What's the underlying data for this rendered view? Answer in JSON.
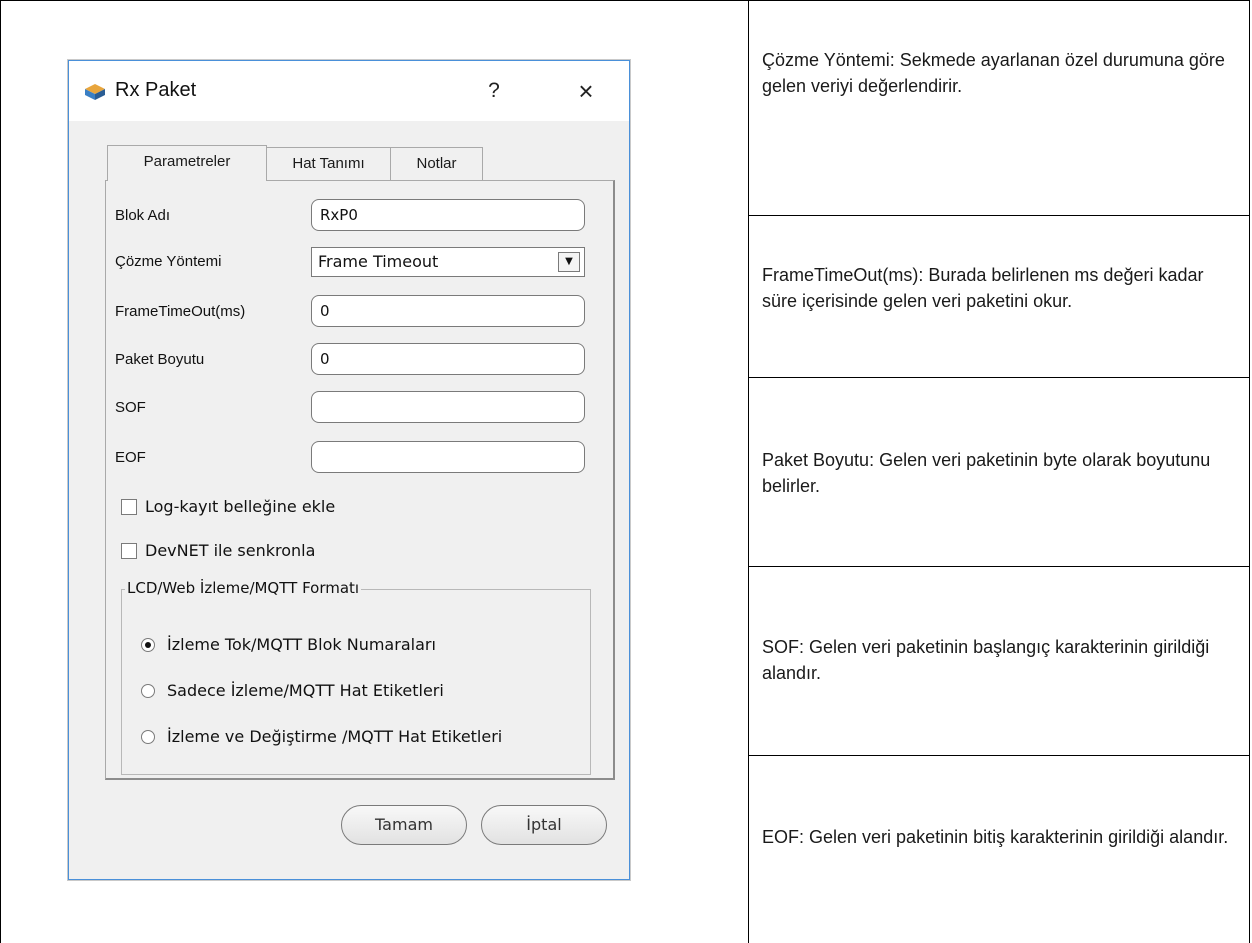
{
  "dialog": {
    "title": "Rx Paket",
    "help_glyph": "?",
    "close_glyph": "×",
    "tabs": [
      "Parametreler",
      "Hat Tanımı",
      "Notlar"
    ],
    "fields": {
      "block_name": {
        "label": "Blok Adı",
        "value": "RxP0"
      },
      "decode_method": {
        "label": "Çözme Yöntemi",
        "value": "Frame Timeout"
      },
      "frame_timeout": {
        "label": "FrameTimeOut(ms)",
        "value": "0"
      },
      "packet_size": {
        "label": "Paket Boyutu",
        "value": "0"
      },
      "sof": {
        "label": "SOF",
        "value": ""
      },
      "eof": {
        "label": "EOF",
        "value": ""
      }
    },
    "checkboxes": [
      {
        "label": "Log-kayıt belleğine ekle",
        "checked": false
      },
      {
        "label": "DevNET ile senkronla",
        "checked": false
      }
    ],
    "group": {
      "legend": "LCD/Web İzleme/MQTT Formatı",
      "options": [
        {
          "label": "İzleme Tok/MQTT Blok Numaraları",
          "selected": true
        },
        {
          "label": "Sadece İzleme/MQTT Hat Etiketleri",
          "selected": false
        },
        {
          "label": "İzleme ve Değiştirme /MQTT Hat Etiketleri",
          "selected": false
        }
      ]
    },
    "ok_label": "Tamam",
    "cancel_label": "İptal"
  },
  "notes": [
    "Çözme Yöntemi:  Sekmede ayarlanan özel durumuna göre gelen veriyi değerlendirir.",
    "FrameTimeOut(ms):  Burada belirlenen ms değeri kadar süre içerisinde gelen veri paketini okur.",
    "Paket Boyutu:  Gelen veri paketinin byte olarak boyutunu belirler.",
    "SOF:  Gelen veri paketinin başlangıç karakterinin girildiği alandır.",
    "EOF:  Gelen veri paketinin bitiş karakterinin girildiği alandır."
  ]
}
